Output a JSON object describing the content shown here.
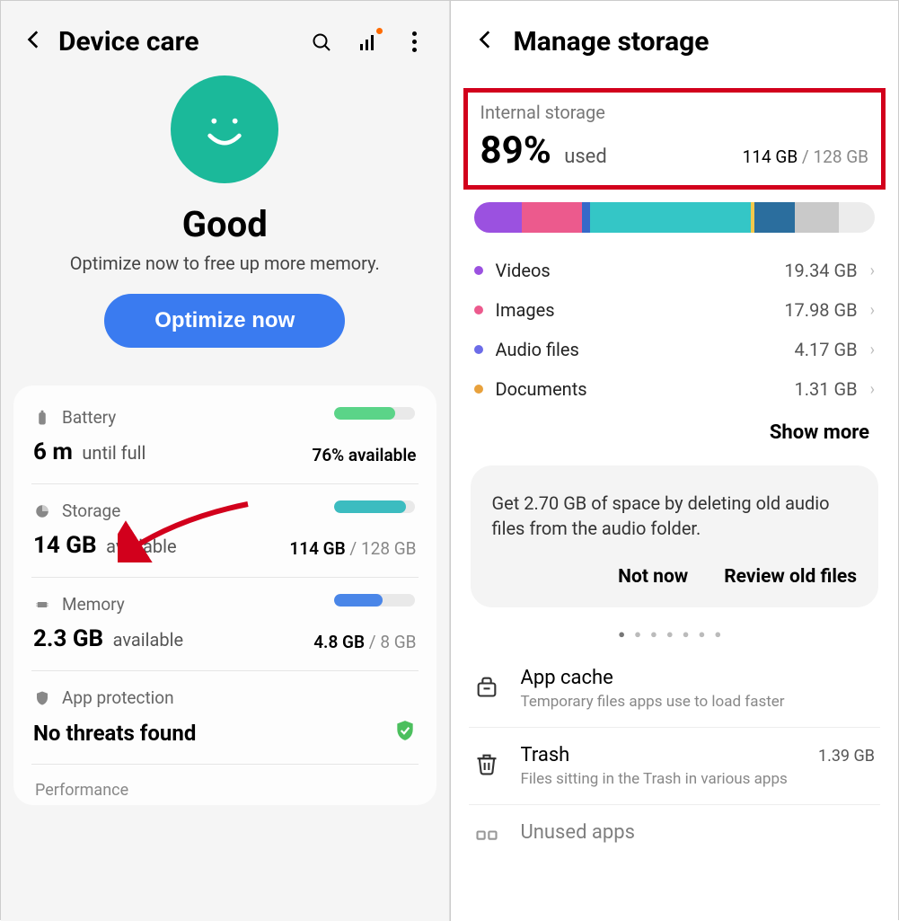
{
  "left": {
    "title": "Device care",
    "hero": {
      "status": "Good",
      "subtitle": "Optimize now to free up more memory.",
      "button": "Optimize now"
    },
    "battery": {
      "label": "Battery",
      "value": "6 m",
      "suffix": "until full",
      "pct_label": "76% available",
      "bar_pct": 76,
      "bar_color": "#5bd488"
    },
    "storage": {
      "label": "Storage",
      "value": "14 GB",
      "suffix": "available",
      "used": "114 GB",
      "total": "128 GB",
      "bar_pct": 89,
      "bar_color": "#3cbcc0"
    },
    "memory": {
      "label": "Memory",
      "value": "2.3 GB",
      "suffix": "available",
      "used": "4.8 GB",
      "total": "8 GB",
      "bar_pct": 60,
      "bar_color": "#4a86e8"
    },
    "protection": {
      "label": "App protection",
      "value": "No threats found"
    },
    "performance_label": "Performance"
  },
  "right": {
    "title": "Manage storage",
    "internal": {
      "label": "Internal storage",
      "pct": "89%",
      "used_word": "used",
      "used": "114 GB",
      "total": "128 GB"
    },
    "segments": [
      {
        "color": "#9b51e0",
        "width": 12
      },
      {
        "color": "#ec5a8d",
        "width": 15
      },
      {
        "color": "#3669c9",
        "width": 2
      },
      {
        "color": "#34c6c6",
        "width": 40
      },
      {
        "color": "#f2c94c",
        "width": 1
      },
      {
        "color": "#2b6e9e",
        "width": 10
      },
      {
        "color": "#c9c9c9",
        "width": 11
      },
      {
        "color": "#ececec",
        "width": 9
      }
    ],
    "categories": [
      {
        "dot": "#9b51e0",
        "label": "Videos",
        "size": "19.34 GB"
      },
      {
        "dot": "#ec5a8d",
        "label": "Images",
        "size": "17.98 GB"
      },
      {
        "dot": "#6c6ce8",
        "label": "Audio files",
        "size": "4.17 GB"
      },
      {
        "dot": "#e8a13c",
        "label": "Documents",
        "size": "1.31 GB"
      }
    ],
    "show_more": "Show more",
    "suggestion": {
      "text": "Get 2.70 GB of space by deleting old audio files from the audio folder.",
      "not_now": "Not now",
      "review": "Review old files"
    },
    "manage": [
      {
        "icon": "cache",
        "title": "App cache",
        "size": "",
        "sub": "Temporary files apps use to load faster"
      },
      {
        "icon": "trash",
        "title": "Trash",
        "size": "1.39 GB",
        "sub": "Files sitting in the Trash in various apps"
      },
      {
        "icon": "apps",
        "title": "Unused apps",
        "size": "",
        "sub": ""
      }
    ]
  }
}
